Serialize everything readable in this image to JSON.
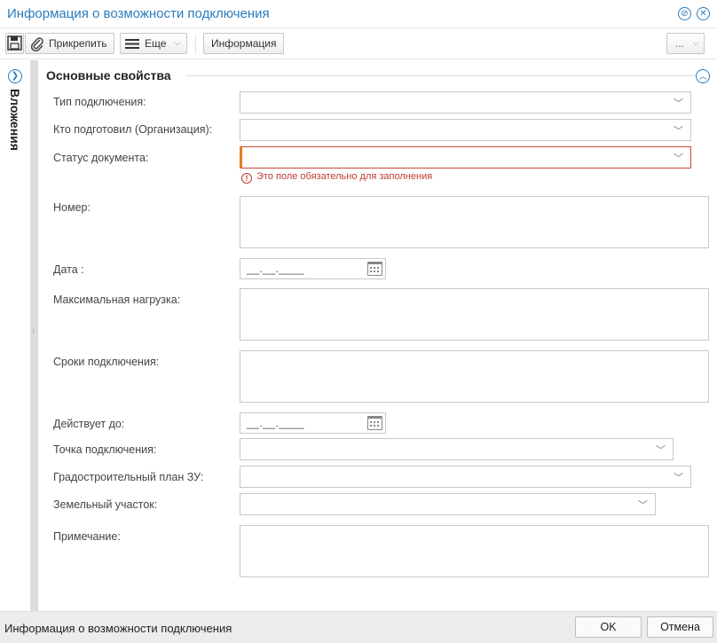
{
  "window": {
    "title": "Информация о возможности подключения"
  },
  "toolbar": {
    "attach_label": "Прикрепить",
    "more_label": "Еще",
    "info_label": "Информация",
    "overflow_label": "..."
  },
  "side_panel": {
    "label": "Вложения"
  },
  "section": {
    "title": "Основные свойства"
  },
  "fields": {
    "connection_type": {
      "label": "Тип подключения:",
      "value": ""
    },
    "prepared_by": {
      "label": "Кто подготовил (Организация):",
      "value": ""
    },
    "doc_status": {
      "label": "Статус документа:",
      "value": "",
      "error": "Это поле обязательно для заполнения"
    },
    "number": {
      "label": "Номер:",
      "value": ""
    },
    "date": {
      "label": "Дата :",
      "placeholder": "__.__.____"
    },
    "max_load": {
      "label": "Максимальная нагрузка:",
      "value": ""
    },
    "connection_terms": {
      "label": "Сроки подключения:",
      "value": ""
    },
    "valid_until": {
      "label": "Действует до:",
      "placeholder": "__.__.____"
    },
    "connection_point": {
      "label": "Точка подключения:",
      "value": ""
    },
    "urban_plan": {
      "label": "Градостроительный план ЗУ:",
      "value": ""
    },
    "land_plot": {
      "label": "Земельный участок:",
      "value": ""
    },
    "note": {
      "label": "Примечание:",
      "value": ""
    }
  },
  "footer": {
    "title": "Информация о возможности подключения",
    "ok_label": "OK",
    "cancel_label": "Отмена"
  },
  "colors": {
    "accent": "#2b7bbd",
    "error": "#c0392b"
  }
}
